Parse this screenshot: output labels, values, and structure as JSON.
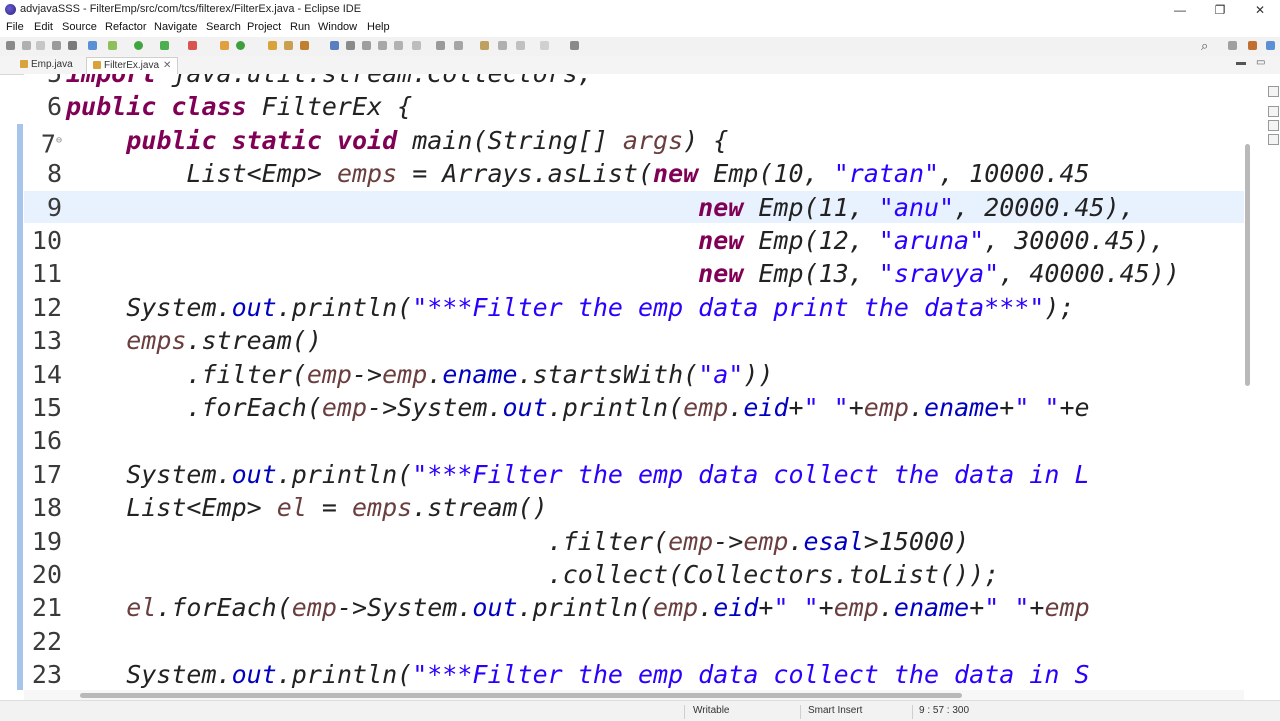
{
  "window": {
    "title": "advjavaSSS - FilterEmp/src/com/tcs/filterex/FilterEx.java - Eclipse IDE",
    "minimize": "—",
    "maximize": "❐",
    "close": "✕"
  },
  "menu": {
    "file": "File",
    "edit": "Edit",
    "source": "Source",
    "refactor": "Refactor",
    "navigate": "Navigate",
    "search": "Search",
    "project": "Project",
    "run": "Run",
    "window": "Window",
    "help": "Help"
  },
  "toolbar": {
    "search_icon": "⌕"
  },
  "tabs": {
    "tab1": "Emp.java",
    "tab2": "FilterEx.java",
    "close": "✕",
    "minimize": "▬",
    "maximize": "▭"
  },
  "editor": {
    "lines": [
      {
        "n": "5",
        "code": [
          {
            "c": "kw",
            "t": "import"
          },
          {
            "t": " java.util.stream.Collectors;"
          }
        ]
      },
      {
        "n": "6",
        "code": [
          {
            "c": "kw",
            "t": "public class "
          },
          {
            "t": "FilterEx {"
          }
        ]
      },
      {
        "n": "7",
        "fold": "⊖",
        "code": [
          {
            "t": "    "
          },
          {
            "c": "kw",
            "t": "public static void "
          },
          {
            "t": "main(String[] "
          },
          {
            "c": "var",
            "t": "args"
          },
          {
            "t": ") {"
          }
        ]
      },
      {
        "n": "8",
        "code": [
          {
            "t": "        List<Emp> "
          },
          {
            "c": "var",
            "t": "emps"
          },
          {
            "t": " = Arrays."
          },
          {
            "t": "asList"
          },
          {
            "t": "("
          },
          {
            "c": "kw",
            "t": "new "
          },
          {
            "t": "Emp(10, "
          },
          {
            "c": "str",
            "t": "\"ratan\""
          },
          {
            "t": ", 10000.45"
          }
        ]
      },
      {
        "n": "9",
        "code": [
          {
            "t": "                                          "
          },
          {
            "c": "kw",
            "t": "new "
          },
          {
            "t": "Emp(11, "
          },
          {
            "c": "str",
            "t": "\"anu\""
          },
          {
            "t": ", 20000.45),"
          }
        ]
      },
      {
        "n": "10",
        "code": [
          {
            "t": "                                          "
          },
          {
            "c": "kw",
            "t": "new "
          },
          {
            "t": "Emp(12, "
          },
          {
            "c": "str",
            "t": "\"aruna\""
          },
          {
            "t": ", 30000.45),"
          }
        ]
      },
      {
        "n": "11",
        "code": [
          {
            "t": "                                          "
          },
          {
            "c": "kw",
            "t": "new "
          },
          {
            "t": "Emp(13, "
          },
          {
            "c": "str",
            "t": "\"sravya\""
          },
          {
            "t": ", 40000.45))"
          }
        ]
      },
      {
        "n": "12",
        "code": [
          {
            "t": "    System."
          },
          {
            "c": "fld",
            "t": "out"
          },
          {
            "t": ".println("
          },
          {
            "c": "str",
            "t": "\"***Filter the emp data print the data***\""
          },
          {
            "t": ");"
          }
        ]
      },
      {
        "n": "13",
        "code": [
          {
            "t": "    "
          },
          {
            "c": "var",
            "t": "emps"
          },
          {
            "t": ".stream()"
          }
        ]
      },
      {
        "n": "14",
        "code": [
          {
            "t": "        .filter("
          },
          {
            "c": "var",
            "t": "emp"
          },
          {
            "t": "->"
          },
          {
            "c": "var",
            "t": "emp"
          },
          {
            "t": "."
          },
          {
            "c": "fld",
            "t": "ename"
          },
          {
            "t": ".startsWith("
          },
          {
            "c": "str",
            "t": "\"a\""
          },
          {
            "t": "))"
          }
        ]
      },
      {
        "n": "15",
        "code": [
          {
            "t": "        .forEach("
          },
          {
            "c": "var",
            "t": "emp"
          },
          {
            "t": "->System."
          },
          {
            "c": "fld",
            "t": "out"
          },
          {
            "t": ".println("
          },
          {
            "c": "var",
            "t": "emp"
          },
          {
            "t": "."
          },
          {
            "c": "fld",
            "t": "eid"
          },
          {
            "t": "+"
          },
          {
            "c": "str",
            "t": "\" \""
          },
          {
            "t": "+"
          },
          {
            "c": "var",
            "t": "emp"
          },
          {
            "t": "."
          },
          {
            "c": "fld",
            "t": "ename"
          },
          {
            "t": "+"
          },
          {
            "c": "str",
            "t": "\" \""
          },
          {
            "t": "+e"
          }
        ]
      },
      {
        "n": "16",
        "code": []
      },
      {
        "n": "17",
        "code": [
          {
            "t": "    System."
          },
          {
            "c": "fld",
            "t": "out"
          },
          {
            "t": ".println("
          },
          {
            "c": "str",
            "t": "\"***Filter the emp data collect the data in L"
          }
        ]
      },
      {
        "n": "18",
        "code": [
          {
            "t": "    List<Emp> "
          },
          {
            "c": "var",
            "t": "el"
          },
          {
            "t": " = "
          },
          {
            "c": "var",
            "t": "emps"
          },
          {
            "t": ".stream()"
          }
        ]
      },
      {
        "n": "19",
        "code": [
          {
            "t": "                                .filter("
          },
          {
            "c": "var",
            "t": "emp"
          },
          {
            "t": "->"
          },
          {
            "c": "var",
            "t": "emp"
          },
          {
            "t": "."
          },
          {
            "c": "fld",
            "t": "esal"
          },
          {
            "t": ">15000)"
          }
        ]
      },
      {
        "n": "20",
        "code": [
          {
            "t": "                                .collect(Collectors."
          },
          {
            "t": "toList"
          },
          {
            "t": "());"
          }
        ]
      },
      {
        "n": "21",
        "code": [
          {
            "t": "    "
          },
          {
            "c": "var",
            "t": "el"
          },
          {
            "t": ".forEach("
          },
          {
            "c": "var",
            "t": "emp"
          },
          {
            "t": "->System."
          },
          {
            "c": "fld",
            "t": "out"
          },
          {
            "t": ".println("
          },
          {
            "c": "var",
            "t": "emp"
          },
          {
            "t": "."
          },
          {
            "c": "fld",
            "t": "eid"
          },
          {
            "t": "+"
          },
          {
            "c": "str",
            "t": "\" \""
          },
          {
            "t": "+"
          },
          {
            "c": "var",
            "t": "emp"
          },
          {
            "t": "."
          },
          {
            "c": "fld",
            "t": "ename"
          },
          {
            "t": "+"
          },
          {
            "c": "str",
            "t": "\" \""
          },
          {
            "t": "+"
          },
          {
            "c": "var",
            "t": "emp"
          }
        ]
      },
      {
        "n": "22",
        "code": []
      },
      {
        "n": "23",
        "code": [
          {
            "t": "    System."
          },
          {
            "c": "fld",
            "t": "out"
          },
          {
            "t": ".println("
          },
          {
            "c": "str",
            "t": "\"***Filter the emp data collect the data in S"
          }
        ]
      }
    ]
  },
  "status": {
    "writable": "Writable",
    "insert_mode": "Smart Insert",
    "position": "9 : 57 : 300"
  },
  "colors": {
    "keyword": "#7f0055",
    "string": "#2a00ff",
    "field": "#0000c0",
    "local_var": "#6a3e3e",
    "current_line": "#e8f2fe"
  }
}
